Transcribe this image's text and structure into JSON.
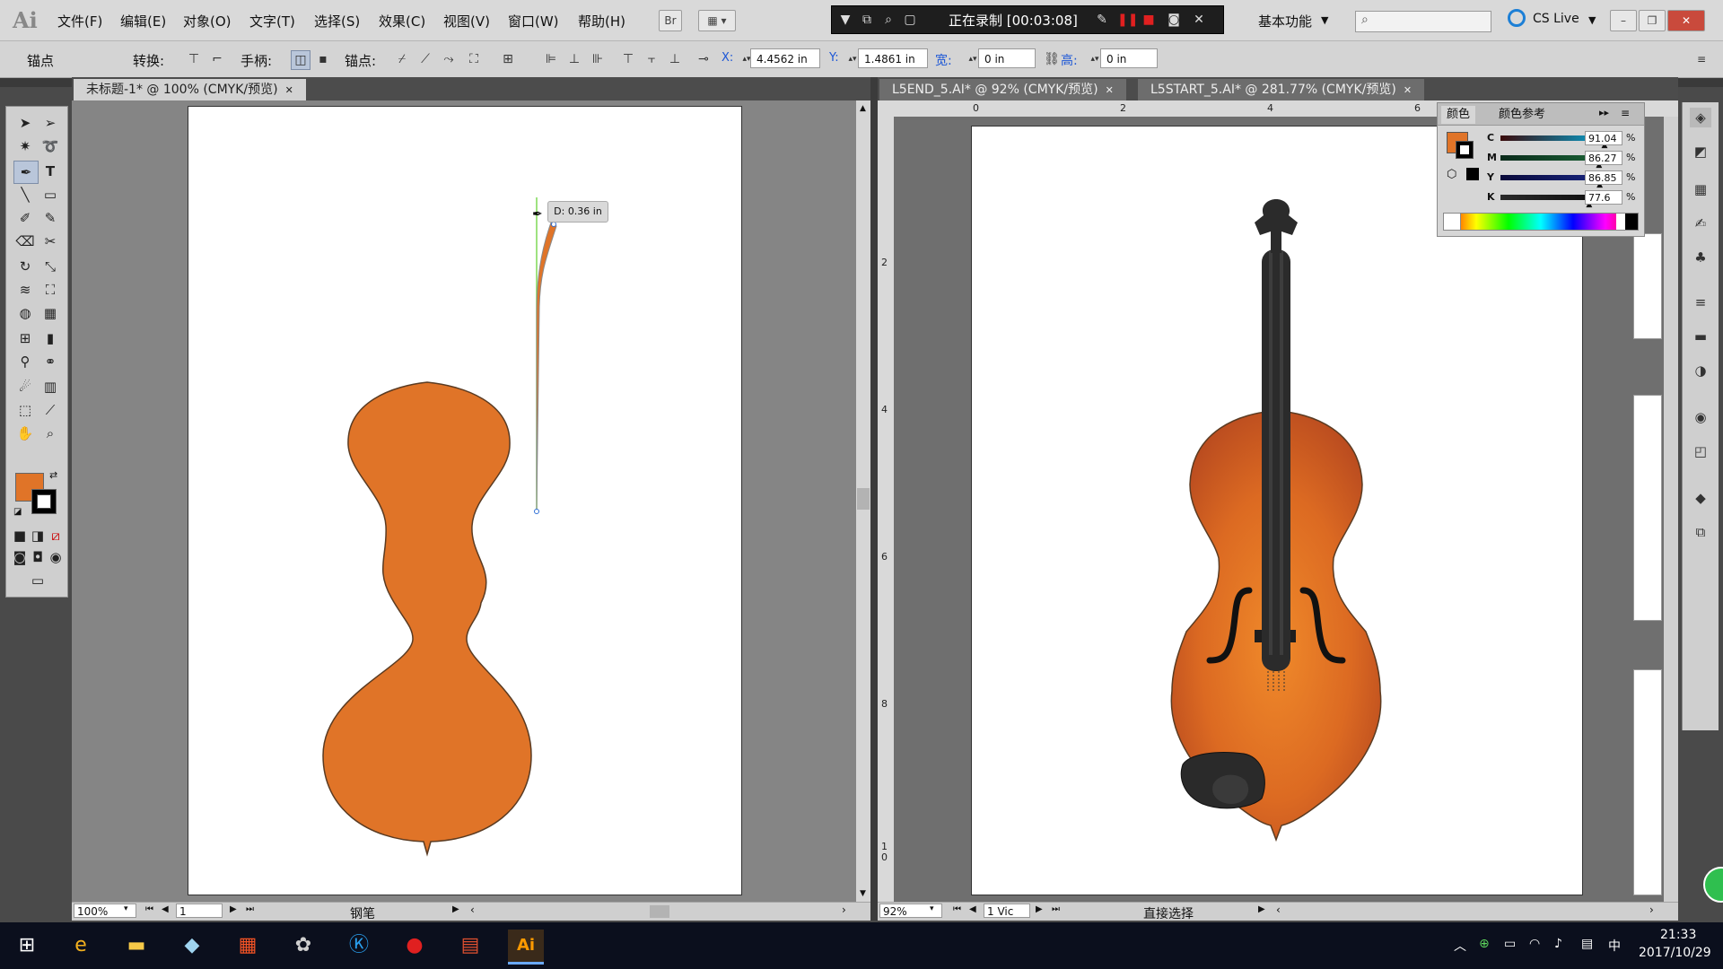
{
  "app": {
    "logo_text": "Ai"
  },
  "menu": [
    "文件(F)",
    "编辑(E)",
    "对象(O)",
    "文字(T)",
    "选择(S)",
    "效果(C)",
    "视图(V)",
    "窗口(W)",
    "帮助(H)"
  ],
  "menu_buttons": {
    "bridge": "Br"
  },
  "recording": {
    "label": "正在录制 [00:03:08]"
  },
  "workspace": {
    "label": "基本功能",
    "cs_live": "CS Live"
  },
  "control_bar": {
    "anchor_label": "锚点",
    "convert_label": "转换:",
    "handles_label": "手柄:",
    "anchors_label": "锚点:",
    "x_label": "X:",
    "x_value": "4.4562 in",
    "y_label": "Y:",
    "y_value": "1.4861 in",
    "width_label": "宽:",
    "width_value": "0 in",
    "height_label": "高:",
    "height_value": "0 in"
  },
  "tabs_left": [
    {
      "label": "未标题-1* @ 100% (CMYK/预览)",
      "active": true
    }
  ],
  "tabs_right": [
    {
      "label": "L5END_5.AI* @ 92% (CMYK/预览)",
      "active": false
    },
    {
      "label": "L5START_5.AI* @ 281.77% (CMYK/预览)",
      "active": false
    }
  ],
  "canvas_left": {
    "tooltip": "D: 0.36 in"
  },
  "status_left": {
    "zoom": "100%",
    "page": "1",
    "tool": "钢笔"
  },
  "status_right": {
    "zoom": "92%",
    "page": "1 Vic",
    "tool": "直接选择"
  },
  "ruler_top_right": [
    "0",
    "2",
    "4",
    "6"
  ],
  "ruler_left_right": [
    "2",
    "4",
    "6",
    "8",
    "1\n0"
  ],
  "color_panel": {
    "tab_color": "颜色",
    "tab_guide": "颜色参考",
    "channels": [
      {
        "name": "C",
        "value": "91.04",
        "unit": "%",
        "level": 0.9104,
        "color": "#00b4e6"
      },
      {
        "name": "M",
        "value": "86.27",
        "unit": "%",
        "level": 0.8627,
        "color": "#e4007f"
      },
      {
        "name": "Y",
        "value": "86.85",
        "unit": "%",
        "level": 0.8685,
        "color": "#ffe100"
      },
      {
        "name": "K",
        "value": "77.6",
        "unit": "%",
        "level": 0.776,
        "color": "#000000"
      }
    ]
  },
  "colors": {
    "fill": "#e07428",
    "stroke": "#000000",
    "violin_body": "#e07428",
    "violin_outline": "#5a3b22"
  },
  "taskbar": {
    "time": "21:33",
    "date": "2017/10/29",
    "ime": "中"
  }
}
